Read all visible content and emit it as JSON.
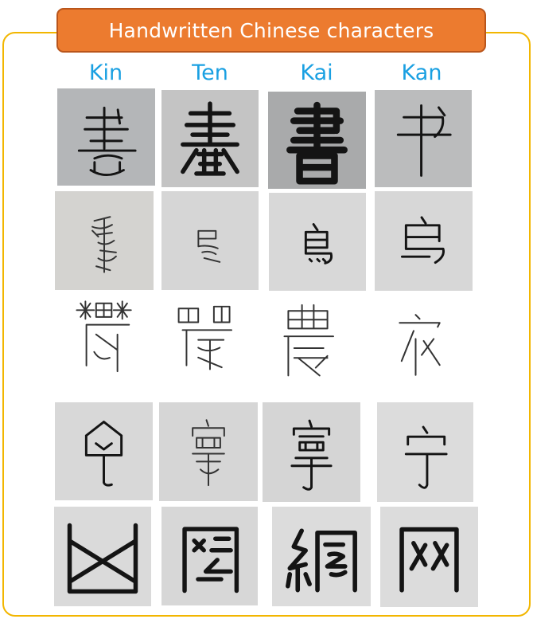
{
  "title": "Handwritten Chinese characters",
  "columns": [
    "Kin",
    "Ten",
    "Kai",
    "Kan"
  ],
  "rows": [
    {
      "characters": [
        "書",
        "書",
        "書",
        "书"
      ]
    },
    {
      "characters": [
        "鳥",
        "鳥",
        "鳥",
        "鸟"
      ]
    },
    {
      "characters": [
        "農",
        "農",
        "農",
        "农"
      ]
    },
    {
      "characters": [
        "寧",
        "寧",
        "寧",
        "宁"
      ]
    },
    {
      "characters": [
        "網",
        "網",
        "網",
        "网"
      ]
    }
  ],
  "colors": {
    "banner": "#ec7b2f",
    "banner_border": "#b9551b",
    "frame": "#f2b600",
    "header_text": "#1aa0e2",
    "title_text": "#ffffff"
  }
}
